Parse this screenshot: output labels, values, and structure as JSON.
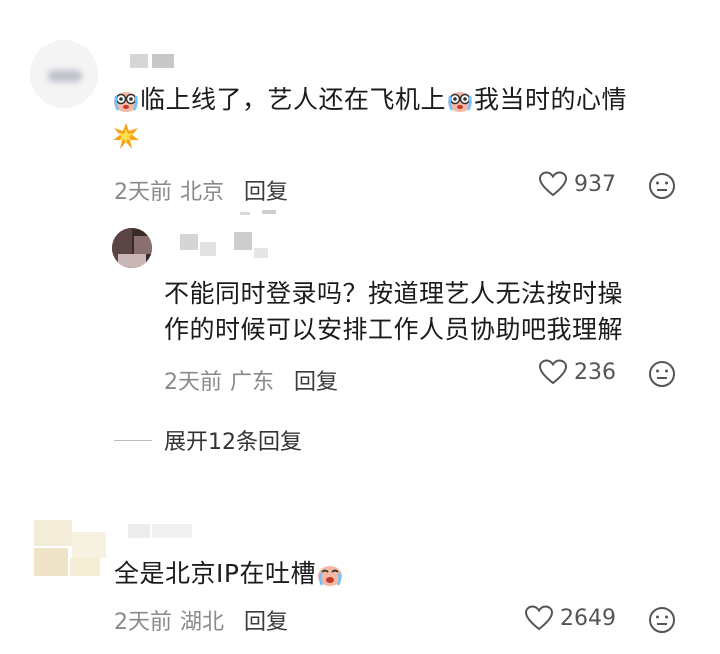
{
  "comments": [
    {
      "text_a": "临上线了，艺人还在飞机上",
      "text_b": "我当时的心情",
      "time": "2天前",
      "location": "北京",
      "reply": "回复",
      "likes": "937",
      "emojis": [
        "crying-face-emoji",
        "explosion-emoji"
      ]
    },
    {
      "line1": "不能同时登录吗？按道理艺人无法按时操",
      "line2": "作的时候可以安排工作人员协助吧我理解",
      "time": "2天前",
      "location": "广东",
      "reply": "回复",
      "likes": "236"
    },
    {
      "text": "全是北京IP在吐槽",
      "time": "2天前",
      "location": "湖北",
      "reply": "回复",
      "likes": "2649",
      "emojis": [
        "crying-face-emoji"
      ]
    }
  ],
  "expand_replies": "展开12条回复",
  "colors": {
    "text": "#1b1b1b",
    "meta": "#8a8a8a",
    "icon": "#555555",
    "background": "#ffffff"
  }
}
